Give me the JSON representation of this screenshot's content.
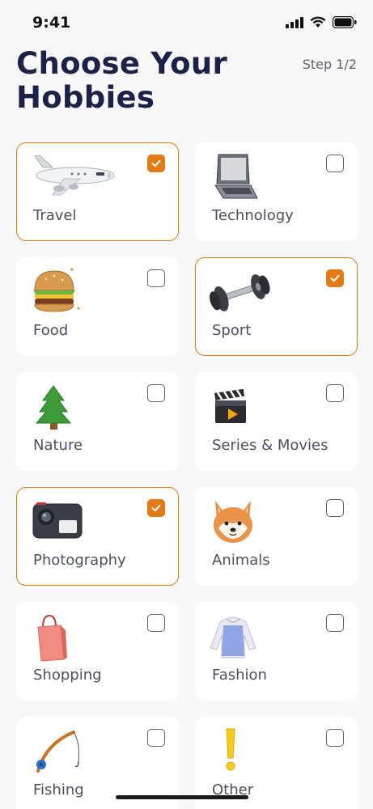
{
  "status": {
    "time": "9:41"
  },
  "header": {
    "title": "Choose Your Hobbies",
    "step": "Step 1/2"
  },
  "hobbies": [
    {
      "label": "Travel",
      "icon": "airplane-icon",
      "selected": true
    },
    {
      "label": "Technology",
      "icon": "laptop-icon",
      "selected": false
    },
    {
      "label": "Food",
      "icon": "burger-icon",
      "selected": false
    },
    {
      "label": "Sport",
      "icon": "dumbbell-icon",
      "selected": true
    },
    {
      "label": "Nature",
      "icon": "tree-icon",
      "selected": false
    },
    {
      "label": "Series & Movies",
      "icon": "clapperboard-icon",
      "selected": false
    },
    {
      "label": "Photography",
      "icon": "camera-icon",
      "selected": true
    },
    {
      "label": "Animals",
      "icon": "dog-icon",
      "selected": false
    },
    {
      "label": "Shopping",
      "icon": "shopping-bag-icon",
      "selected": false
    },
    {
      "label": "Fashion",
      "icon": "sweater-icon",
      "selected": false
    },
    {
      "label": "Fishing",
      "icon": "fishing-rod-icon",
      "selected": false
    },
    {
      "label": "Other",
      "icon": "exclamation-icon",
      "selected": false
    }
  ],
  "colors": {
    "accent": "#E27A17",
    "title": "#1C2147",
    "background": "#F8F8FB"
  }
}
